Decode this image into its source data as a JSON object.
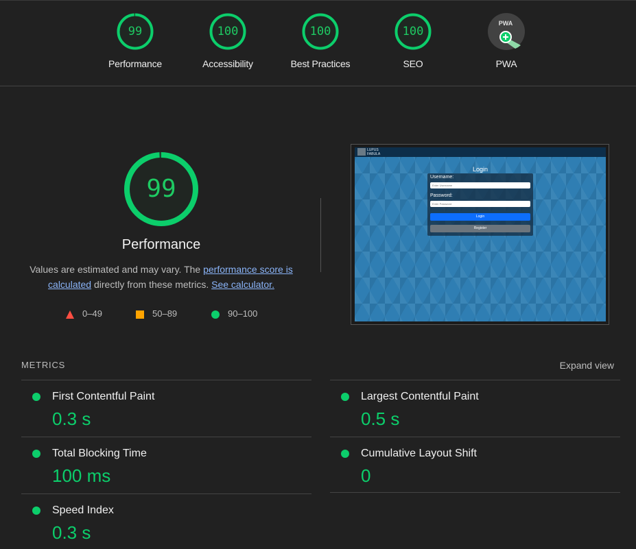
{
  "categories": [
    {
      "id": "performance",
      "score": "99",
      "label": "Performance",
      "fraction": 0.99
    },
    {
      "id": "accessibility",
      "score": "100",
      "label": "Accessibility",
      "fraction": 1.0
    },
    {
      "id": "best-practices",
      "score": "100",
      "label": "Best Practices",
      "fraction": 1.0
    },
    {
      "id": "seo",
      "score": "100",
      "label": "SEO",
      "fraction": 1.0
    },
    {
      "id": "pwa",
      "score": "",
      "label": "PWA",
      "badge_text": "PWA"
    }
  ],
  "performance": {
    "score": "99",
    "fraction": 0.99,
    "title": "Performance",
    "desc_prefix": "Values are estimated and may vary. The ",
    "desc_link1": "performance score is calculated",
    "desc_middle": " directly from these metrics. ",
    "desc_link2": "See calculator."
  },
  "legend": {
    "fail": "0–49",
    "average": "50–89",
    "pass": "90–100"
  },
  "screenshot": {
    "brand_line1": "LUPUS",
    "brand_line2": "FABULA",
    "login_title": "Login",
    "username_label": "Username:",
    "username_placeholder": "Enter Username",
    "password_label": "Password:",
    "password_placeholder": "Enter Password",
    "login_button": "Login",
    "register_button": "Register"
  },
  "metrics": {
    "title": "METRICS",
    "expand_label": "Expand view",
    "items": [
      {
        "name": "First Contentful Paint",
        "value": "0.3 s"
      },
      {
        "name": "Largest Contentful Paint",
        "value": "0.5 s"
      },
      {
        "name": "Total Blocking Time",
        "value": "100 ms"
      },
      {
        "name": "Cumulative Layout Shift",
        "value": "0"
      },
      {
        "name": "Speed Index",
        "value": "0.3 s"
      }
    ]
  },
  "colors": {
    "pass": "#0cce6b",
    "average": "#ffa400",
    "fail": "#ff4e42",
    "background": "#212121"
  }
}
